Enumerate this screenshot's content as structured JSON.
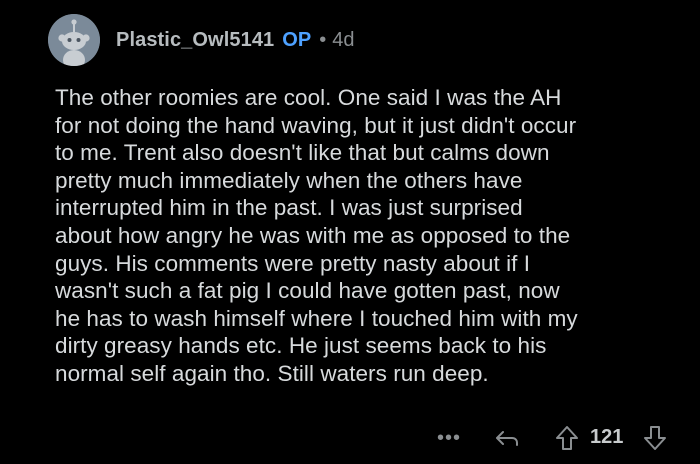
{
  "comment": {
    "author": "Plastic_Owl5141",
    "op_badge": "OP",
    "separator": "•",
    "age": "4d",
    "avatar_icon": "reddit-snoo-avatar-icon",
    "body": "The other roomies are cool.  One said I was the AH\nfor not doing the hand waving, but it just didn't occur\nto me.  Trent also doesn't like that but calms down\npretty much immediately when the others have\ninterrupted him in the past.  I was just surprised\nabout how angry he was with me as opposed to the\nguys.  His comments were pretty nasty about if I\nwasn't such a fat pig I could have gotten past, now\nhe has to wash himself where I touched him with my\ndirty greasy hands etc.   He just seems back to his\nnormal self again tho.  Still waters run deep.",
    "actions": {
      "more_label": "•••",
      "more_icon": "more-options-icon",
      "reply_icon": "reply-arrow-icon",
      "upvote_icon": "upvote-arrow-icon",
      "score": "121",
      "downvote_icon": "downvote-arrow-icon"
    }
  },
  "colors": {
    "background": "#000000",
    "text": "#d7dadc",
    "username": "#b7bcbf",
    "op_badge": "#4ea1ff",
    "meta": "#8a8e91",
    "avatar_bg": "#7b8a99"
  }
}
